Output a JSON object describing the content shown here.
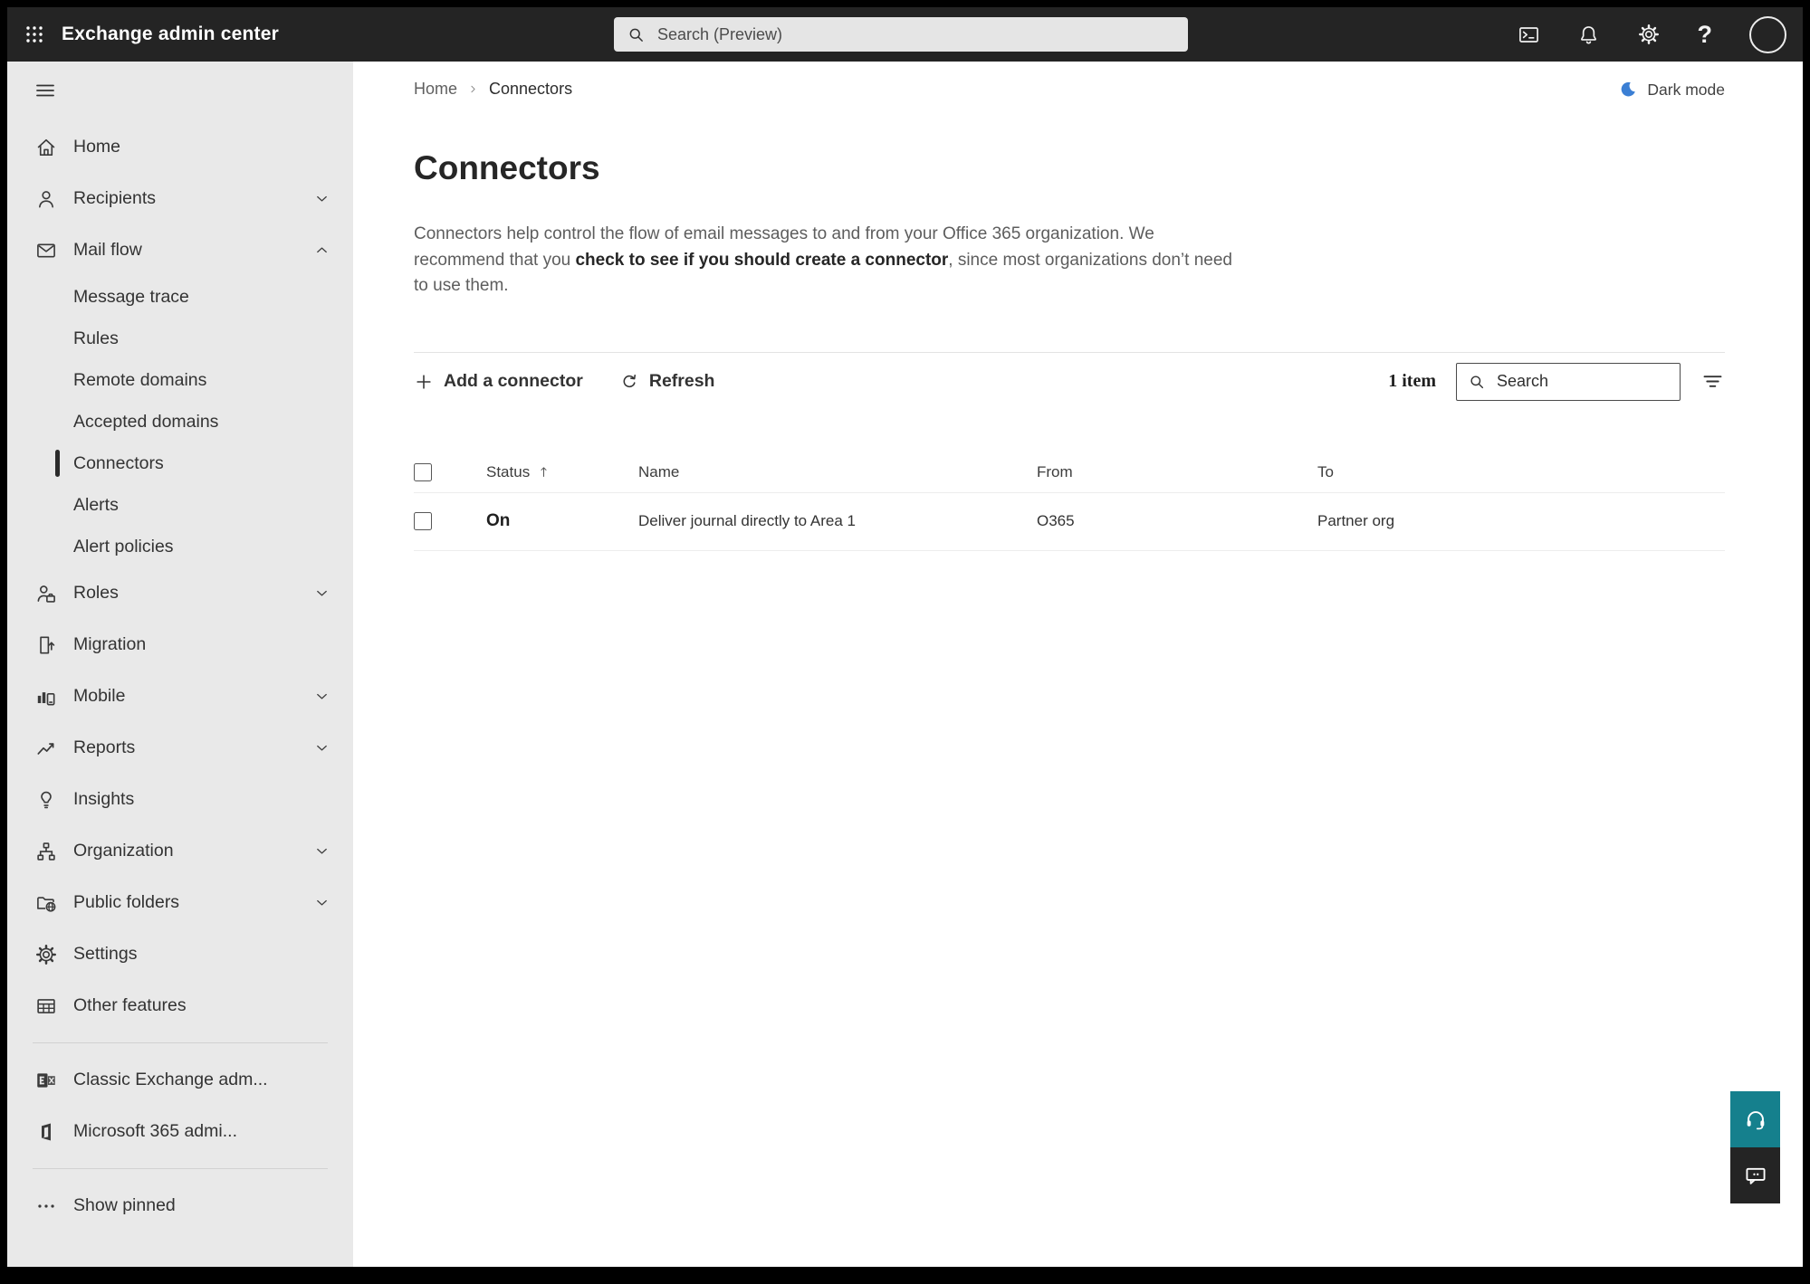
{
  "topbar": {
    "app_title": "Exchange admin center",
    "search_placeholder": "Search (Preview)",
    "icons": [
      "app-launcher-icon",
      "terminal-icon",
      "bell-icon",
      "gear-icon",
      "help-icon",
      "avatar"
    ]
  },
  "sidebar": {
    "items": [
      {
        "label": "Home",
        "icon": "home-icon"
      },
      {
        "label": "Recipients",
        "icon": "person-icon",
        "chevron": "down"
      },
      {
        "label": "Mail flow",
        "icon": "mail-icon",
        "chevron": "up"
      },
      {
        "label": "Message trace",
        "sub": true
      },
      {
        "label": "Rules",
        "sub": true
      },
      {
        "label": "Remote domains",
        "sub": true
      },
      {
        "label": "Accepted domains",
        "sub": true
      },
      {
        "label": "Connectors",
        "sub": true,
        "selected": true
      },
      {
        "label": "Alerts",
        "sub": true
      },
      {
        "label": "Alert policies",
        "sub": true
      },
      {
        "label": "Roles",
        "icon": "roles-icon",
        "chevron": "down"
      },
      {
        "label": "Migration",
        "icon": "migration-icon"
      },
      {
        "label": "Mobile",
        "icon": "mobile-icon",
        "chevron": "down"
      },
      {
        "label": "Reports",
        "icon": "reports-icon",
        "chevron": "down"
      },
      {
        "label": "Insights",
        "icon": "insights-icon"
      },
      {
        "label": "Organization",
        "icon": "organization-icon",
        "chevron": "down"
      },
      {
        "label": "Public folders",
        "icon": "public-folders-icon",
        "chevron": "down"
      },
      {
        "label": "Settings",
        "icon": "gear-icon"
      },
      {
        "label": "Other features",
        "icon": "table-icon"
      },
      {
        "divider": true
      },
      {
        "label": "Classic Exchange adm...",
        "icon": "exchange-logo-icon"
      },
      {
        "label": "Microsoft 365 admi...",
        "icon": "m365-logo-icon"
      },
      {
        "divider": true
      },
      {
        "label": "Show pinned",
        "icon": "ellipsis-icon"
      }
    ]
  },
  "main": {
    "breadcrumb": {
      "home": "Home",
      "current": "Connectors"
    },
    "dark_mode_label": "Dark mode",
    "title": "Connectors",
    "description": {
      "part1": "Connectors help control the flow of email messages to and from your Office 365 organization. We recommend that you ",
      "link": "check to see if you should create a connector",
      "part2": ", since most organizations don’t need to use them."
    },
    "toolbar": {
      "add_label": "Add a connector",
      "refresh_label": "Refresh",
      "item_count": "1 item",
      "search_placeholder": "Search"
    },
    "table": {
      "columns": [
        {
          "label": "Status",
          "sort": "asc"
        },
        {
          "label": "Name"
        },
        {
          "label": "From"
        },
        {
          "label": "To"
        }
      ],
      "rows": [
        {
          "status": "On",
          "name": "Deliver journal directly to Area 1",
          "from": "O365",
          "to": "Partner org"
        }
      ]
    }
  },
  "colors": {
    "topbar_bg": "#242424",
    "sidebar_bg": "#e9e9e9",
    "accent_moon_blue": "#3b7fd4",
    "support_teal": "#15808d",
    "feedback_dark": "#242424"
  }
}
